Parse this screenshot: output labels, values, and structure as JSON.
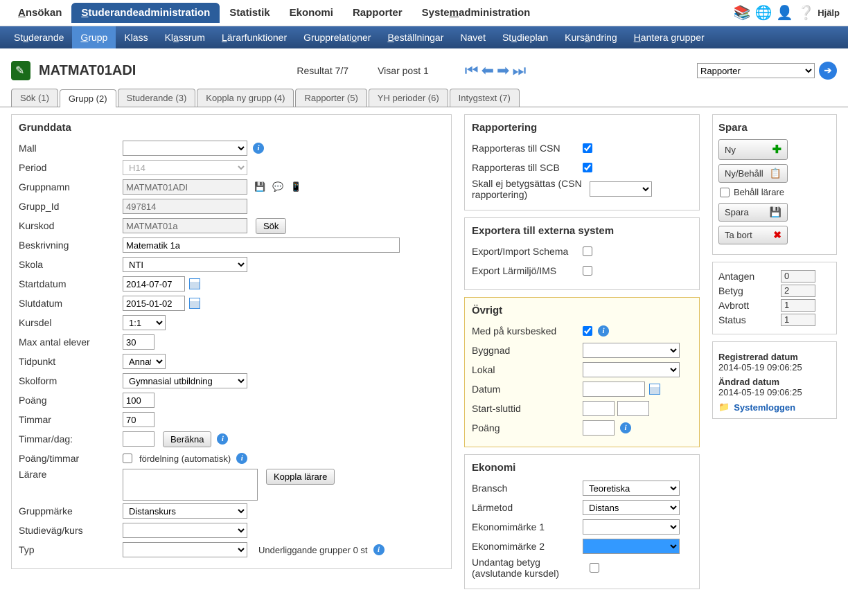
{
  "top_nav": {
    "items": [
      "Ansökan",
      "Studerandeadministration",
      "Statistik",
      "Ekonomi",
      "Rapporter",
      "Systemadministration"
    ],
    "underline": [
      "A",
      "S",
      "",
      "",
      "",
      "m"
    ],
    "active_index": 1,
    "help_label": "Hjälp"
  },
  "sub_nav": {
    "items": [
      "Studerande",
      "Grupp",
      "Klass",
      "Klassrum",
      "Lärarfunktioner",
      "Grupprelationer",
      "Beställningar",
      "Navet",
      "Studieplan",
      "Kursändring",
      "Hantera grupper"
    ],
    "underline": [
      "u",
      "G",
      "",
      "",
      "L",
      "",
      "B",
      "",
      "u",
      "ä",
      "H"
    ],
    "active_index": 1
  },
  "header": {
    "title": "MATMAT01ADI",
    "result": "Resultat 7/7",
    "post": "Visar post 1",
    "dropdown": "Rapporter"
  },
  "tabs": [
    "Sök (1)",
    "Grupp (2)",
    "Studerande (3)",
    "Koppla ny grupp (4)",
    "Rapporter (5)",
    "YH perioder (6)",
    "Intygstext (7)"
  ],
  "tabs_active": 1,
  "grunddata": {
    "title": "Grunddata",
    "mall_label": "Mall",
    "period_label": "Period",
    "period_value": "H14",
    "gruppnamn_label": "Gruppnamn",
    "gruppnamn_value": "MATMAT01ADI",
    "gruppid_label": "Grupp_Id",
    "gruppid_value": "497814",
    "kurskod_label": "Kurskod",
    "kurskod_value": "MATMAT01a",
    "sok_btn": "Sök",
    "beskrivning_label": "Beskrivning",
    "beskrivning_value": "Matematik 1a",
    "skola_label": "Skola",
    "skola_value": "NTI",
    "startdatum_label": "Startdatum",
    "startdatum_value": "2014-07-07",
    "slutdatum_label": "Slutdatum",
    "slutdatum_value": "2015-01-02",
    "kursdel_label": "Kursdel",
    "kursdel_value": "1:1",
    "max_label": "Max antal elever",
    "max_value": "30",
    "tidpunkt_label": "Tidpunkt",
    "tidpunkt_value": "Annat",
    "skolform_label": "Skolform",
    "skolform_value": "Gymnasial utbildning",
    "poang_label": "Poäng",
    "poang_value": "100",
    "timmar_label": "Timmar",
    "timmar_value": "70",
    "timmardag_label": "Timmar/dag:",
    "berakna_btn": "Beräkna",
    "poangtimmar_label": "Poäng/timmar",
    "fordelning_label": "fördelning (automatisk)",
    "larare_label": "Lärare",
    "koppla_btn": "Koppla lärare",
    "gruppmarke_label": "Gruppmärke",
    "gruppmarke_value": "Distanskurs",
    "studievag_label": "Studieväg/kurs",
    "typ_label": "Typ",
    "underliggande": "Underliggande grupper 0 st"
  },
  "rapportering": {
    "title": "Rapportering",
    "csn_label": "Rapporteras till CSN",
    "csn": true,
    "scb_label": "Rapporteras till SCB",
    "scb": true,
    "betyg_label": "Skall ej betygsättas (CSN rapportering)"
  },
  "export": {
    "title": "Exportera till externa system",
    "schema_label": "Export/Import Schema",
    "larmiljo_label": "Export Lärmiljö/IMS"
  },
  "ovrigt": {
    "title": "Övrigt",
    "kursbesked_label": "Med på kursbesked",
    "kursbesked": true,
    "byggnad_label": "Byggnad",
    "lokal_label": "Lokal",
    "datum_label": "Datum",
    "startslut_label": "Start-sluttid",
    "poang_label": "Poäng"
  },
  "ekonomi": {
    "title": "Ekonomi",
    "bransch_label": "Bransch",
    "bransch_value": "Teoretiska",
    "larmetod_label": "Lärmetod",
    "larmetod_value": "Distans",
    "marke1_label": "Ekonomimärke 1",
    "marke2_label": "Ekonomimärke 2",
    "undantag_label": "Undantag betyg (avslutande kursdel)"
  },
  "spara": {
    "title": "Spara",
    "ny": "Ny",
    "nybehall": "Ny/Behåll",
    "behall_larare": "Behåll lärare",
    "spara": "Spara",
    "tabort": "Ta bort"
  },
  "stats": {
    "antagen_label": "Antagen",
    "antagen": "0",
    "betyg_label": "Betyg",
    "betyg": "2",
    "avbrott_label": "Avbrott",
    "avbrott": "1",
    "status_label": "Status",
    "status": "1"
  },
  "meta": {
    "reg_label": "Registrerad datum",
    "reg_value": "2014-05-19 09:06:25",
    "andrad_label": "Ändrad datum",
    "andrad_value": "2014-05-19 09:06:25",
    "syslog": "Systemloggen"
  }
}
